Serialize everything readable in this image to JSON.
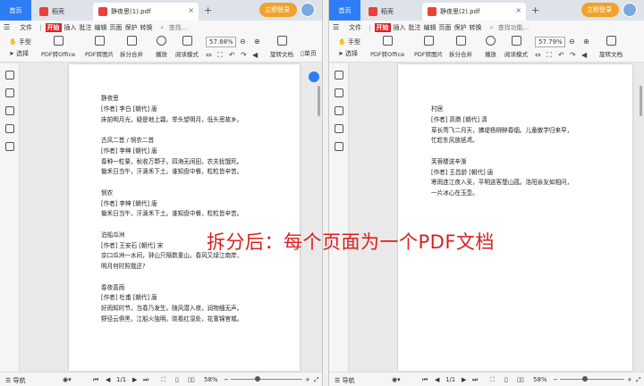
{
  "caption": "拆分后：每个页面为一个PDF文档",
  "left": {
    "tabs": {
      "home": "首页",
      "daoke": "稻壳",
      "active": "静夜思(1).pdf",
      "close": "×",
      "add": "+"
    },
    "login": "立即登录",
    "menu": [
      "文件",
      "开始",
      "插入",
      "批注",
      "编辑",
      "页面",
      "保护",
      "转换"
    ],
    "search": "查找...",
    "toolbar": {
      "hand": "手型",
      "select": "选择",
      "pdf_to_office": "PDF转Office",
      "pdf_to_image": "PDF转图片",
      "split_merge": "拆分合并",
      "play": "播放",
      "read_mode": "阅读模式",
      "zoom": "57.88%",
      "rotate": "旋转文档",
      "single": "单页"
    },
    "page_lines": [
      "静夜思",
      "[作者] 李白 [朝代] 唐",
      "床前明月光，疑是地上霜。举头望明月，低头思故乡。",
      "",
      "古风二首 / 悯农二首",
      "[作者] 李绅 [朝代] 唐",
      "春种一粒粟，秋收万颗子。四海无闲田，农夫犹饿死。",
      "锄禾日当午，汗滴禾下土。谁知盘中餐，粒粒皆辛苦。",
      "",
      "悯农",
      "[作者] 李绅 [朝代] 唐",
      "锄禾日当午，汗滴禾下土。谁知盘中餐，粒粒皆辛苦。",
      "",
      "泊船瓜洲",
      "[作者] 王安石 [朝代] 宋",
      "京口瓜洲一水间，钟山只隔数重山。春风又绿江南岸，",
      "明月何时照我还?",
      "",
      "春夜喜雨",
      "[作者] 杜甫 [朝代] 唐",
      "好雨知时节，当春乃发生。随风潜入夜，润物细无声。",
      "野径云俱黑，江船火独明。晓看红湿处，花重锦官城。"
    ],
    "status": {
      "nav": "导航",
      "page": "1/1",
      "zoom": "58%",
      "minus": "−",
      "plus": "+"
    }
  },
  "right": {
    "tabs": {
      "home": "首页",
      "daoke": "稻壳",
      "active": "静夜思(2).pdf",
      "close": "×",
      "add": "+"
    },
    "login": "立即登录",
    "menu": [
      "文件",
      "开始",
      "插入",
      "批注",
      "编辑",
      "页面",
      "保护",
      "转换"
    ],
    "search": "查找功能...",
    "toolbar": {
      "hand": "手型",
      "select": "选择",
      "pdf_to_office": "PDF转Office",
      "pdf_to_image": "PDF转图片",
      "split_merge": "拆分合并",
      "play": "播放",
      "read_mode": "阅读模式",
      "zoom": "57.79%",
      "rotate": "旋转文档"
    },
    "page_lines": [
      "村居",
      "[作者] 高鼎 [朝代] 清",
      "草长莺飞二月天，拂堤杨柳醉春烟。儿童散学归来早，",
      "忙趁东风放纸鸢。",
      "",
      "芙蓉楼送辛渐",
      "[作者] 王昌龄 [朝代] 唐",
      "寒雨连江夜入吴，平明送客楚山孤。洛阳亲友如相问，",
      "一片冰心在玉壶。"
    ],
    "status": {
      "nav": "导航",
      "page": "1/1",
      "zoom": "58%",
      "minus": "−",
      "plus": "+"
    }
  }
}
